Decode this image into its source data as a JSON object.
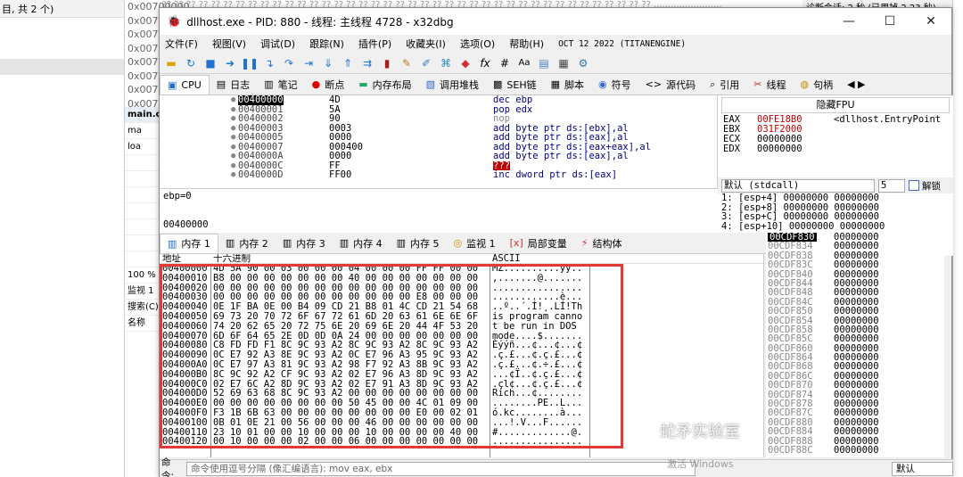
{
  "background": {
    "left_top_text": "目, 共 2 个)",
    "hex_addrs": [
      "0x00700000",
      "0x007",
      "0x007",
      "0x007",
      "0x007",
      "0x007",
      "0x007",
      "0x007"
    ],
    "top_strip": "?? ?? ?? ?? ?? ?? ?? ?? ?? ?? ?? ?? ?? ?? ?? ?? ?? ?? ?? ?? ?? ?? ?? ?? ?? ?? ?? ?? ?? ?? ?? ?? ?? ?? ?? ?? ?? ?? ?? ?? ?? ?? ?? ........................",
    "right_head": "诊断会话: 2 秒 (已用掉 2.23 秒)",
    "side_items": [
      "main.c",
      "ma",
      "loa",
      "",
      "",
      "",
      "",
      "",
      "",
      "",
      "100 %",
      "监视 1",
      "搜索(C)",
      "名称"
    ]
  },
  "window": {
    "title": "dllhost.exe - PID: 880 - 线程: 主线程 4728 - x32dbg",
    "controls": [
      "—",
      "☐",
      "✕"
    ]
  },
  "menu": [
    "文件(F)",
    "视图(V)",
    "调试(D)",
    "跟踪(N)",
    "插件(P)",
    "收藏夹(I)",
    "选项(O)",
    "帮助(H)",
    "OCT 12 2022 (TITANENGINE)"
  ],
  "tabs": [
    "CPU",
    "日志",
    "笔记",
    "断点",
    "内存布局",
    "调用堆栈",
    "SEH链",
    "脚本",
    "符号",
    "源代码",
    "引用",
    "线程",
    "句柄"
  ],
  "disasm": [
    {
      "addr": "00400000",
      "bytes": "4D",
      "ins": "dec ebp"
    },
    {
      "addr": "00400001",
      "bytes": "5A",
      "ins": "pop edx"
    },
    {
      "addr": "00400002",
      "bytes": "90",
      "ins": "nop"
    },
    {
      "addr": "00400003",
      "bytes": "0003",
      "ins": "add byte ptr ds:[ebx],al"
    },
    {
      "addr": "00400005",
      "bytes": "0000",
      "ins": "add byte ptr ds:[eax],al"
    },
    {
      "addr": "00400007",
      "bytes": "000400",
      "ins": "add byte ptr ds:[eax+eax],al"
    },
    {
      "addr": "0040000A",
      "bytes": "0000",
      "ins": "add byte ptr ds:[eax],al"
    },
    {
      "addr": "0040000C",
      "bytes": "FF",
      "ins": "???"
    },
    {
      "addr": "0040000D",
      "bytes": "FF00",
      "ins": "inc dword ptr ds:[eax]"
    }
  ],
  "registers": {
    "header": "隐藏FPU",
    "rows": [
      {
        "name": "EAX",
        "value": "00FE18B0",
        "comment": "<dllhost.EntryPoint"
      },
      {
        "name": "EBX",
        "value": "031F2000",
        "comment": ""
      },
      {
        "name": "ECX",
        "value": "00000000",
        "comment": ""
      },
      {
        "name": "EDX",
        "value": "00000000",
        "comment": ""
      }
    ]
  },
  "callconv": {
    "label": "默认 (stdcall)",
    "count": "5",
    "unlock": "解锁"
  },
  "stack_args": [
    "1: [esp+4] 00000000 00000000",
    "2: [esp+8] 00000000 00000000",
    "3: [esp+C] 00000000 00000000",
    "4: [esp+10] 00000000 00000000"
  ],
  "info": {
    "line1": "ebp=0",
    "line2": "00400000"
  },
  "dump_tabs": [
    "内存 1",
    "内存 2",
    "内存 3",
    "内存 4",
    "内存 5",
    "监视 1",
    "局部变量",
    "结构体"
  ],
  "dump_header": {
    "addr": "地址",
    "hex": "十六进制",
    "ascii": "ASCII"
  },
  "dump": [
    {
      "addr": "00400000",
      "hex": "4D 5A 90 00 03 00 00 00 04 00 00 00 FF FF 00 00",
      "ascii": "MZ..........ÿÿ.."
    },
    {
      "addr": "00400010",
      "hex": "B8 00 00 00 00 00 00 00 40 00 00 00 00 00 00 00",
      "ascii": ",.......@......."
    },
    {
      "addr": "00400020",
      "hex": "00 00 00 00 00 00 00 00 00 00 00 00 00 00 00 00",
      "ascii": "................"
    },
    {
      "addr": "00400030",
      "hex": "00 00 00 00 00 00 00 00 00 00 00 00 E8 00 00 00",
      "ascii": "............è..."
    },
    {
      "addr": "00400040",
      "hex": "0E 1F BA 0E 00 B4 09 CD 21 B8 01 4C CD 21 54 68",
      "ascii": "..º..´.Í!¸.LÍ!Th"
    },
    {
      "addr": "00400050",
      "hex": "69 73 20 70 72 6F 67 72 61 6D 20 63 61 6E 6E 6F",
      "ascii": "is program canno"
    },
    {
      "addr": "00400060",
      "hex": "74 20 62 65 20 72 75 6E 20 69 6E 20 44 4F 53 20",
      "ascii": "t be run in DOS "
    },
    {
      "addr": "00400070",
      "hex": "6D 6F 64 65 2E 0D 0D 0A 24 00 00 00 00 00 00 00",
      "ascii": "mode....$......."
    },
    {
      "addr": "00400080",
      "hex": "C8 FD FD F1 8C 9C 93 A2 8C 9C 93 A2 8C 9C 93 A2",
      "ascii": "Èýýñ...¢...¢...¢"
    },
    {
      "addr": "00400090",
      "hex": "0C E7 92 A3 8E 9C 93 A2 0C E7 96 A3 95 9C 93 A2",
      "ascii": ".ç.£...¢.ç.£...¢"
    },
    {
      "addr": "004000A0",
      "hex": "0C E7 97 A3 81 9C 93 A2 98 F7 92 A3 8B 9C 93 A2",
      "ascii": ".ç.£...¢.÷.£...¢"
    },
    {
      "addr": "004000B0",
      "hex": "8C 9C 92 A2 CF 9C 93 A2 02 E7 96 A3 8D 9C 93 A2",
      "ascii": "...¢Ï..¢.ç.£...¢"
    },
    {
      "addr": "004000C0",
      "hex": "02 E7 6C A2 8D 9C 93 A2 02 E7 91 A3 8D 9C 93 A2",
      "ascii": ".çl¢...¢.ç.£...¢"
    },
    {
      "addr": "004000D0",
      "hex": "52 69 63 68 8C 9C 93 A2 00 00 00 00 00 00 00 00",
      "ascii": "Rich...¢........"
    },
    {
      "addr": "004000E0",
      "hex": "00 00 00 00 00 00 00 00 50 45 00 00 4C 01 09 00",
      "ascii": "........PE..L..."
    },
    {
      "addr": "004000F0",
      "hex": "F3 1B 6B 63 00 00 00 00 00 00 00 00 E0 00 02 01",
      "ascii": "ó.kc........à..."
    },
    {
      "addr": "00400100",
      "hex": "0B 01 0E 21 00 56 00 00 00 46 00 00 00 00 00 00",
      "ascii": "...!.V...F......"
    },
    {
      "addr": "00400110",
      "hex": "23 10 01 00 00 10 00 00 00 10 00 00 00 00 40 00",
      "ascii": "#.............@."
    },
    {
      "addr": "00400120",
      "hex": "00 10 00 00 00 02 00 00 06 00 00 00 00 00 00 00",
      "ascii": "................"
    }
  ],
  "stack": [
    "00CDF830",
    "00CDF834",
    "00CDF838",
    "00CDF83C",
    "00CDF840",
    "00CDF844",
    "00CDF848",
    "00CDF84C",
    "00CDF850",
    "00CDF854",
    "00CDF858",
    "00CDF85C",
    "00CDF860",
    "00CDF864",
    "00CDF868",
    "00CDF86C",
    "00CDF870",
    "00CDF874",
    "00CDF878",
    "00CDF87C",
    "00CDF880",
    "00CDF884",
    "00CDF888",
    "00CDF88C"
  ],
  "stack_value": "00000000",
  "command": {
    "label": "命令:",
    "placeholder": "命令使用逗号分隔 (像汇编语言): mov eax, ebx",
    "default": "默认"
  },
  "watermark": "蛇矛实验室",
  "activate": "激活 Windows"
}
